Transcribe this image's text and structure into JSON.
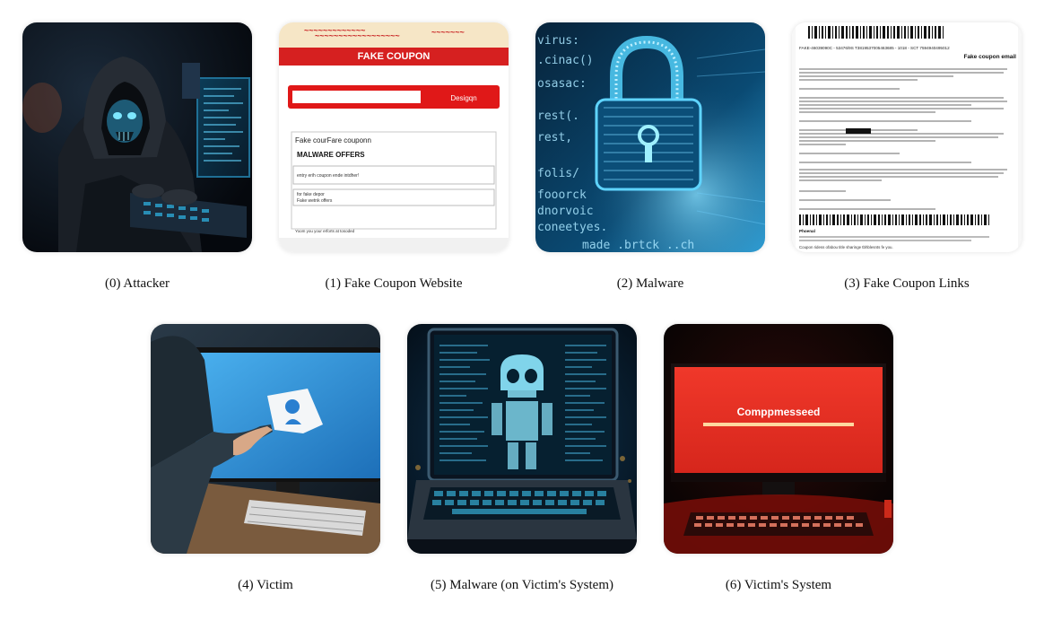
{
  "panels": [
    {
      "caption": "(0) Attacker",
      "icon": "hooded-hacker-icon"
    },
    {
      "caption": "(1) Fake Coupon Website",
      "icon": "fake-coupon-webpage-icon",
      "banner": "FAKE COUPON",
      "button": "Desigqn",
      "box_title": "Fake courFare couponn",
      "offers": "MALWARE OFFERS",
      "line_a": "entry erih coupon ende intdher!",
      "line_b": "for fake depor",
      "line_c": "Fake wetnk offers",
      "footer": "Yoom you your erforts at tosoded"
    },
    {
      "caption": "(2) Malware",
      "icon": "padlock-icon",
      "code": [
        "virus:",
        ".cinac()",
        "osasac:",
        "rest(.",
        "rest,",
        "folis/",
        "fooorck",
        "dnorvoic",
        "coneetyes.",
        "made .brtck ..ch"
      ]
    },
    {
      "caption": "(3) Fake Coupon Links",
      "icon": "phishing-email-document-icon",
      "doc_title": "Fake coupon email",
      "doc_code": "FAKE-46039090C - 53476/9S T3819537005463685 - 1018 - SCT 7594940495012",
      "foot_a": "Phoenal",
      "foot_b": "Coupon ridess ofabou title sharinge tbhblesnts fe you."
    },
    {
      "caption": "(4) Victim",
      "icon": "victim-at-monitor-icon"
    },
    {
      "caption": "(5) Malware (on Victim's System)",
      "icon": "skull-laptop-icon"
    },
    {
      "caption": "(6) Victim's System",
      "icon": "compromised-screen-icon",
      "screen_text": "Comppmesseed"
    }
  ]
}
